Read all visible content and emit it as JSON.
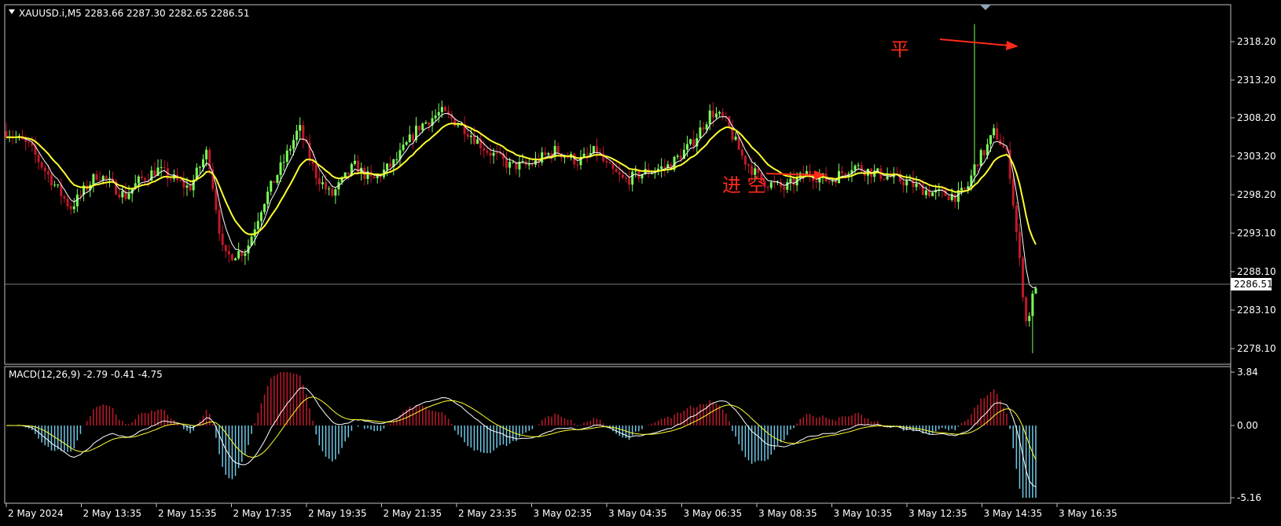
{
  "main_panel": {
    "header": "XAUUSD.i,M5  2283.66 2287.30 2282.65 2286.51",
    "price_labels": [
      "2318.20",
      "2313.20",
      "2308.20",
      "2303.20",
      "2298.20",
      "2293.10",
      "2288.10",
      "2283.10",
      "2278.10"
    ],
    "current_price_label": "2286.51",
    "annotation_close": "平",
    "annotation_entry": "进 空"
  },
  "macd_panel": {
    "header": "MACD(12,26,9) -2.79 -0.41 -4.75",
    "value_labels": [
      "3.84",
      "0.00",
      "-5.16"
    ]
  },
  "time_labels": [
    "2 May 2024",
    "2 May 13:35",
    "2 May 15:35",
    "2 May 17:35",
    "2 May 19:35",
    "2 May 21:35",
    "2 May 23:35",
    "3 May 02:35",
    "3 May 04:35",
    "3 May 06:35",
    "3 May 08:35",
    "3 May 10:35",
    "3 May 12:35",
    "3 May 14:35",
    "3 May 16:35"
  ],
  "colors": {
    "background": "#000000",
    "frame": "#c0c0c0",
    "bull_candle": "#7cff5a",
    "bear_candle": "#c0192a",
    "ma_fast": "#ffffff",
    "ma_slow": "#ffff2e",
    "hist_pos": "#c0192a",
    "hist_neg": "#6fc7e6",
    "annotation": "#ff2a1a",
    "price_line": "#7a7a7a"
  },
  "chart_data": {
    "type": "candlestick",
    "symbol": "XAUUSD.i",
    "timeframe": "M5",
    "ohlc_last": {
      "open": 2283.66,
      "high": 2287.3,
      "low": 2282.65,
      "close": 2286.51
    },
    "price_ylim": [
      2276.0,
      2322.0
    ],
    "bars": 320,
    "close_path": [
      [
        0,
        2306.5
      ],
      [
        10,
        2304.5
      ],
      [
        20,
        2300
      ],
      [
        28,
        2296.5
      ],
      [
        40,
        2301
      ],
      [
        52,
        2298
      ],
      [
        58,
        2300
      ],
      [
        66,
        2301.5
      ],
      [
        80,
        2299
      ],
      [
        88,
        2304
      ],
      [
        95,
        2290
      ],
      [
        105,
        2291
      ],
      [
        112,
        2297
      ],
      [
        122,
        2303
      ],
      [
        128,
        2307
      ],
      [
        135,
        2301
      ],
      [
        142,
        2298
      ],
      [
        152,
        2302
      ],
      [
        160,
        2300
      ],
      [
        170,
        2302.5
      ],
      [
        180,
        2307
      ],
      [
        190,
        2309
      ],
      [
        200,
        2307
      ],
      [
        210,
        2304
      ],
      [
        220,
        2302
      ],
      [
        228,
        2302
      ],
      [
        240,
        2304
      ],
      [
        250,
        2302.5
      ],
      [
        258,
        2304
      ],
      [
        262,
        2302
      ],
      [
        270,
        2300
      ],
      [
        278,
        2301
      ],
      [
        290,
        2302
      ],
      [
        300,
        2305
      ],
      [
        308,
        2309
      ],
      [
        314,
        2308
      ],
      [
        322,
        2303
      ],
      [
        330,
        2300
      ],
      [
        340,
        2299
      ],
      [
        350,
        2301
      ],
      [
        360,
        2300
      ],
      [
        370,
        2302
      ],
      [
        380,
        2301
      ],
      [
        392,
        2300
      ],
      [
        404,
        2298.5
      ],
      [
        416,
        2298
      ],
      [
        420,
        2299
      ],
      [
        424,
        2302.5
      ],
      [
        428,
        2304
      ],
      [
        432,
        2306.5
      ],
      [
        438,
        2303
      ],
      [
        442,
        2292
      ],
      [
        446,
        2281
      ],
      [
        448,
        2284
      ],
      [
        450,
        2286.5
      ]
    ],
    "spike_high": 2320.5,
    "spike_low": 2277.5,
    "macd": {
      "params": [
        12,
        26,
        9
      ],
      "macd": -2.79,
      "signal": -0.41,
      "hist": -4.75,
      "ylim": [
        -5.16,
        3.84
      ]
    }
  }
}
